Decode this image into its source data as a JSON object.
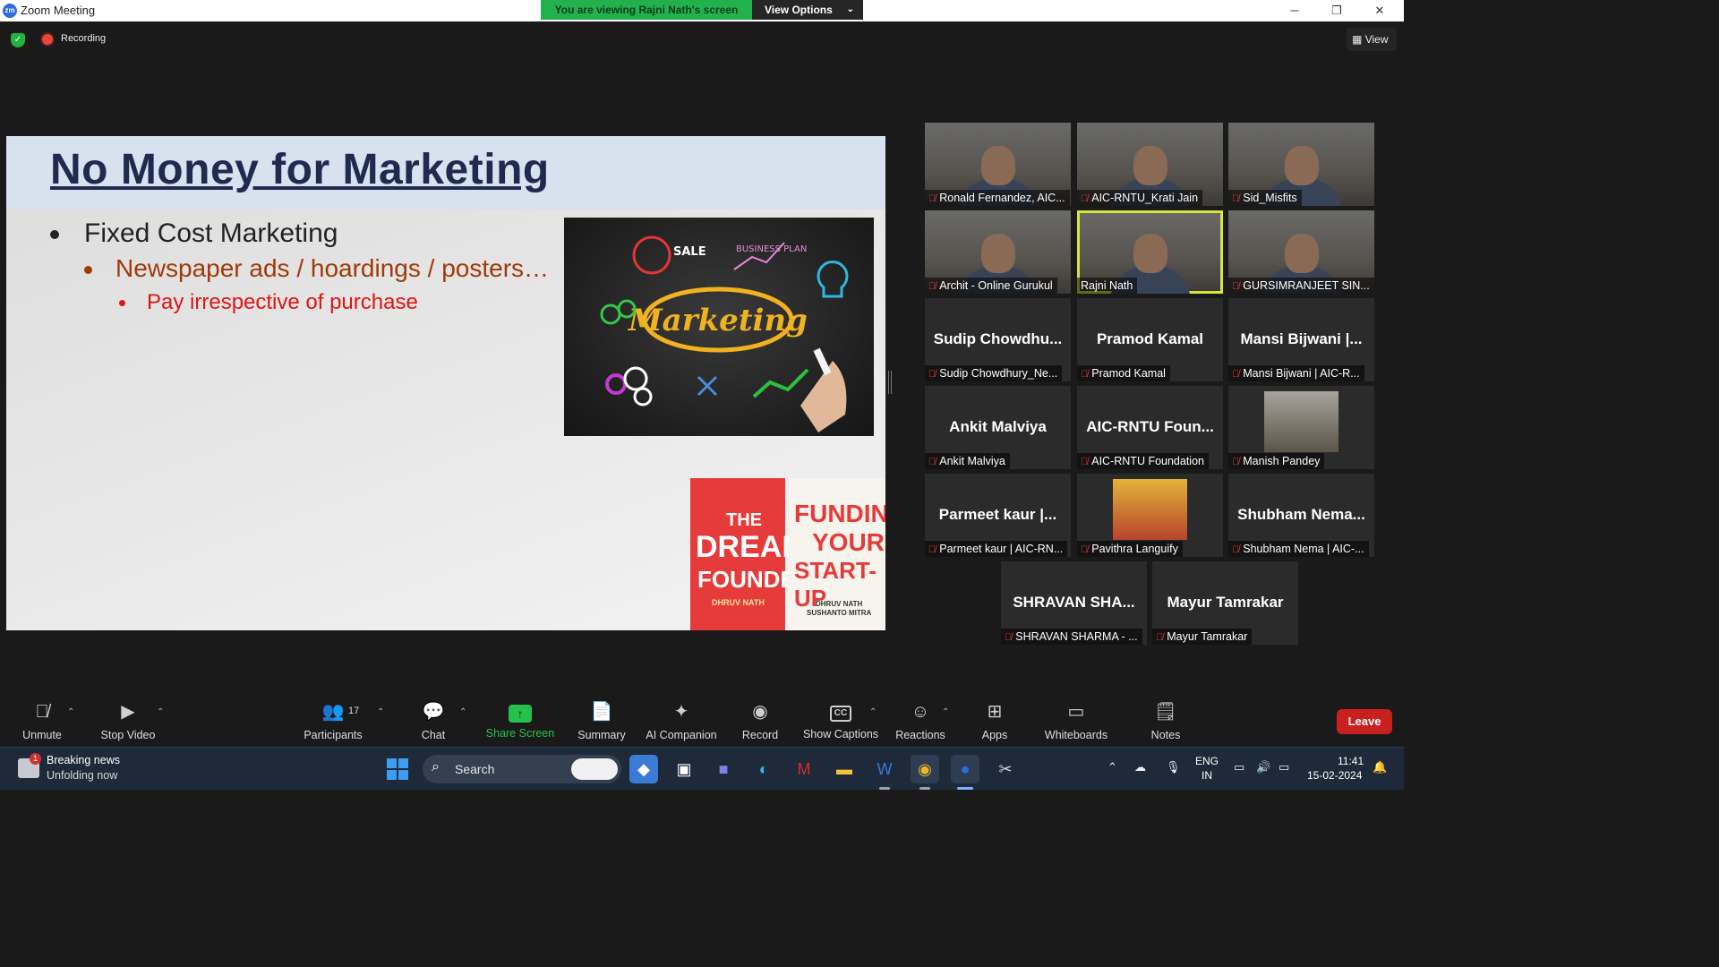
{
  "window": {
    "title": "Zoom Meeting",
    "logo_text": "zm",
    "viewing_banner": "You are viewing Rajni Nath's screen",
    "view_options": "View Options",
    "minimize": "─",
    "restore": "❐",
    "close": "✕"
  },
  "meeting_bar": {
    "recording_label": "Recording",
    "view_label": "View"
  },
  "slide": {
    "title": "No Money for Marketing",
    "bullet1": "Fixed Cost Marketing",
    "bullet2": "Newspaper ads / hoardings / posters…",
    "bullet3": "Pay irrespective of purchase",
    "image_words": {
      "center": "Marketing",
      "sale": "SALE",
      "business_plan": "BUSINESS PLAN"
    },
    "book1": {
      "line1": "THE",
      "line2": "DREAM",
      "line3": "FOUNDER",
      "author": "DHRUV NATH"
    },
    "book2": {
      "line1": "FUNDING",
      "line2": "YOUR",
      "line3": "START-UP",
      "author1": "DHRUV NATH",
      "author2": "SUSHANTO MITRA"
    }
  },
  "participants": [
    {
      "caption": "Ronald Fernandez, AIC...",
      "video": true
    },
    {
      "caption": "AIC-RNTU_Krati Jain",
      "video": true
    },
    {
      "caption": "Sid_Misfits",
      "video": true
    },
    {
      "caption": "Archit - Online Gurukul",
      "video": true
    },
    {
      "caption": "Rajni Nath",
      "video": true,
      "active": true
    },
    {
      "caption": "GURSIMRANJEET SIN...",
      "video": true
    },
    {
      "big": "Sudip Chowdhu...",
      "caption": "Sudip Chowdhury_Ne..."
    },
    {
      "big": "Pramod Kamal",
      "caption": "Pramod Kamal"
    },
    {
      "big": "Mansi Bijwani |...",
      "caption": "Mansi Bijwani | AIC-R..."
    },
    {
      "big": "Ankit Malviya",
      "caption": "Ankit Malviya"
    },
    {
      "big": "AIC-RNTU Foun...",
      "caption": "AIC-RNTU Foundation"
    },
    {
      "caption": "Manish Pandey",
      "photo": true
    },
    {
      "big": "Parmeet kaur |...",
      "caption": "Parmeet kaur | AIC-RN..."
    },
    {
      "caption": "Pavithra Languify",
      "photo": true
    },
    {
      "big": "Shubham Nema...",
      "caption": "Shubham Nema | AIC-..."
    },
    {
      "big": "SHRAVAN SHA...",
      "caption": "SHRAVAN SHARMA - ..."
    },
    {
      "big": "Mayur Tamrakar",
      "caption": "Mayur Tamrakar"
    }
  ],
  "toolbar": {
    "unmute": "Unmute",
    "stop_video": "Stop Video",
    "participants": "Participants",
    "participant_count": "17",
    "chat": "Chat",
    "share_screen": "Share Screen",
    "summary": "Summary",
    "ai_companion": "AI Companion",
    "record": "Record",
    "show_captions": "Show Captions",
    "reactions": "Reactions",
    "apps": "Apps",
    "whiteboards": "Whiteboards",
    "notes": "Notes",
    "leave": "Leave"
  },
  "taskbar": {
    "news_title": "Breaking news",
    "news_sub": "Unfolding now",
    "news_badge": "1",
    "search": "Search",
    "lang1": "ENG",
    "lang2": "IN",
    "time": "11:41",
    "date": "15-02-2024"
  },
  "colors": {
    "accent_green": "#23b14d",
    "leave_red": "#c8201f",
    "active_speaker": "#d6e63a",
    "muted_red": "#e23a3a"
  }
}
